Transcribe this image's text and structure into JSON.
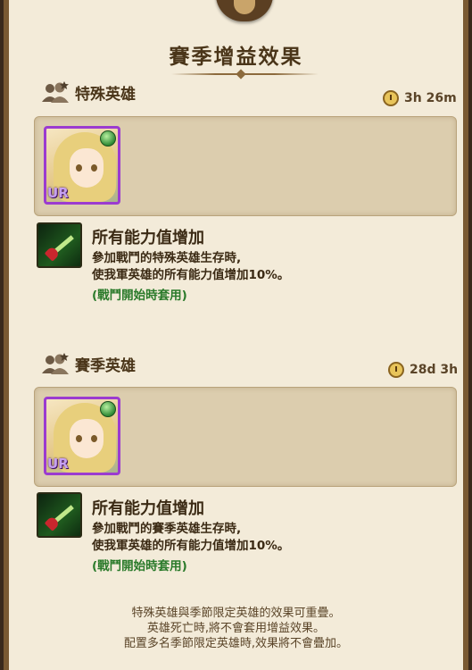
{
  "title": "賽季增益效果",
  "sections": [
    {
      "header": "特殊英雄",
      "timer": "3h 26m",
      "hero": {
        "rarity": "UR"
      },
      "skill": {
        "title": "所有能力值增加",
        "desc_line1": "參加戰鬥的特殊英雄生存時,",
        "desc_line2": "使我軍英雄的所有能力值增加10%。",
        "note": "(戰鬥開始時套用)"
      }
    },
    {
      "header": "賽季英雄",
      "timer": "28d 3h",
      "hero": {
        "rarity": "UR"
      },
      "skill": {
        "title": "所有能力值增加",
        "desc_line1": "參加戰鬥的賽季英雄生存時,",
        "desc_line2": "使我軍英雄的所有能力值增加10%。",
        "note": "(戰鬥開始時套用)"
      }
    }
  ],
  "footer": {
    "line1": "特殊英雄與季節限定英雄的效果可重疊。",
    "line2": "英雄死亡時,將不會套用增益效果。",
    "line3": "配置多名季節限定英雄時,效果將不會疊加。"
  },
  "colors": {
    "panel_bg": "#f3ebd9",
    "box_bg": "#dccdae",
    "note_green": "#2a7a2a",
    "ur_frame": "#9b3bd0"
  }
}
